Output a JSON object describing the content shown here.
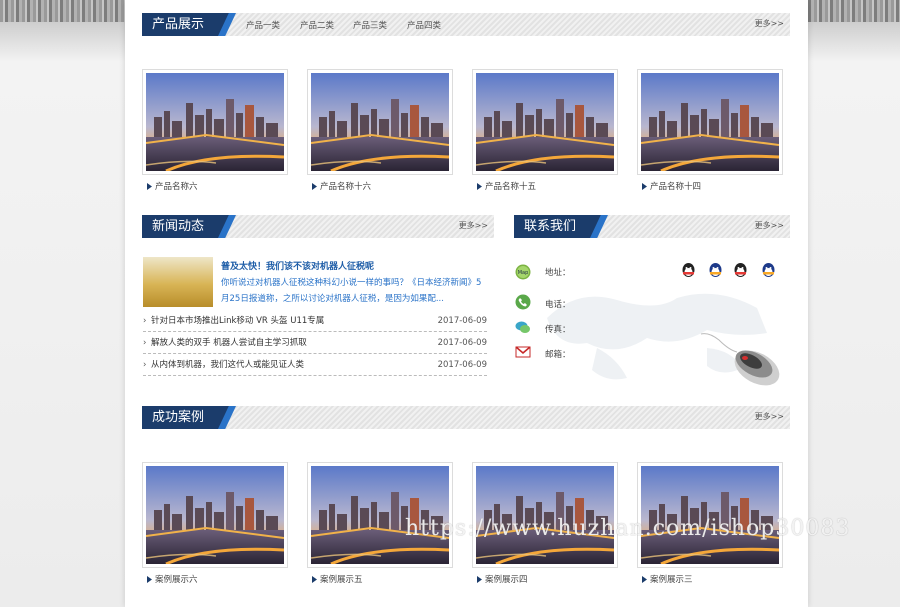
{
  "products": {
    "title": "产品展示",
    "categories": [
      "产品一类",
      "产品二类",
      "产品三类",
      "产品四类"
    ],
    "more": "更多>>",
    "items": [
      {
        "caption": "产品名称六"
      },
      {
        "caption": "产品名称十六"
      },
      {
        "caption": "产品名称十五"
      },
      {
        "caption": "产品名称十四"
      }
    ]
  },
  "news": {
    "title": "新闻动态",
    "more": "更多>>",
    "feature": {
      "title": "普及太快！我们该不该对机器人征税呢",
      "desc": "你听说过对机器人征税这种科幻小说一样的事吗？《日本经济新闻》5月25日报道称，之所以讨论对机器人征税，是因为如果配..."
    },
    "list": [
      {
        "title": "针对日本市场推出Link移动 VR 头盔 U11专属",
        "date": "2017-06-09"
      },
      {
        "title": "解放人类的双手 机器人尝试自主学习抓取",
        "date": "2017-06-09"
      },
      {
        "title": "从内体到机器，我们这代人或能见证人类",
        "date": "2017-06-09"
      }
    ]
  },
  "contact": {
    "title": "联系我们",
    "more": "更多>>",
    "address_label": "地址：",
    "phone_label": "电话：",
    "fax_label": "传真：",
    "email_label": "邮箱：",
    "map_badge": "Map"
  },
  "cases": {
    "title": "成功案例",
    "more": "更多>>",
    "items": [
      {
        "caption": "案例展示六"
      },
      {
        "caption": "案例展示五"
      },
      {
        "caption": "案例展示四"
      },
      {
        "caption": "案例展示三"
      }
    ]
  },
  "watermark": "https://www.huzhan.com/ishop30083",
  "colors": {
    "brand": "#1b3c6b",
    "accent": "#2a73c8",
    "link": "#1f5ea8"
  }
}
